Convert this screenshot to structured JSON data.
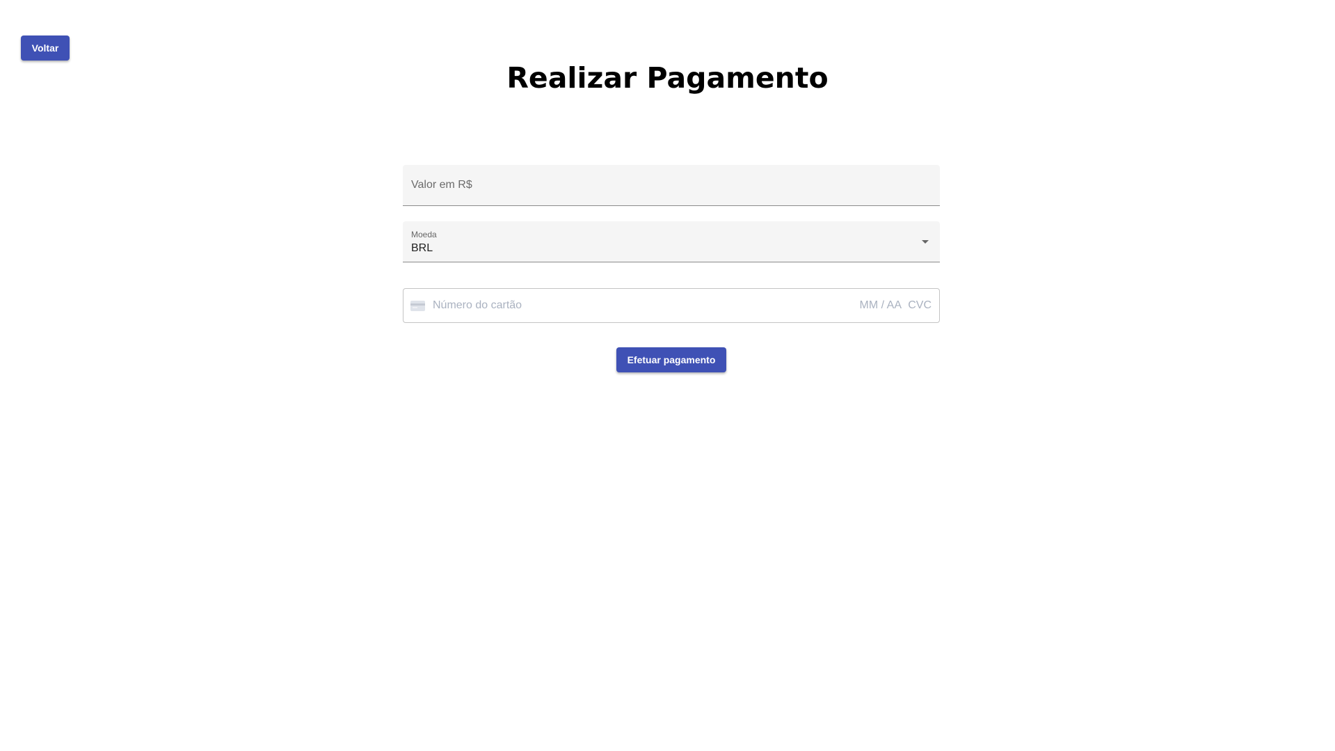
{
  "header": {
    "back_label": "Voltar",
    "title": "Realizar Pagamento"
  },
  "form": {
    "amount": {
      "placeholder": "Valor em R$"
    },
    "currency": {
      "label": "Moeda",
      "value": "BRL",
      "icon": "chevron-down-icon"
    },
    "card": {
      "icon": "credit-card-icon",
      "number_placeholder": "Número do cartão",
      "expiry_placeholder": "MM / AA",
      "cvc_placeholder": "CVC"
    },
    "submit_label": "Efetuar pagamento"
  },
  "colors": {
    "primary": "#3f51b5",
    "field_background": "#f5f5f5",
    "placeholder_card": "#aab2c0"
  }
}
